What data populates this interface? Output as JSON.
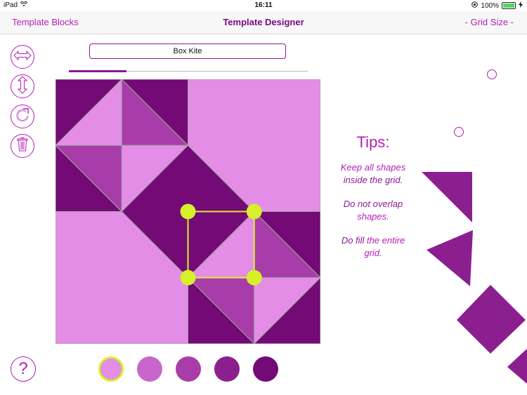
{
  "status_bar": {
    "device": "iPad",
    "time": "16:11",
    "battery": "100%",
    "battery_level": 1.0
  },
  "nav": {
    "left_label": "Template Blocks",
    "title": "Template Designer",
    "right_label": "- Grid Size -"
  },
  "template_name": {
    "value": "Box Kite"
  },
  "progress": {
    "value": 0.24
  },
  "tools": [
    {
      "name": "flip-horizontal-icon"
    },
    {
      "name": "flip-vertical-icon"
    },
    {
      "name": "rotate-icon"
    },
    {
      "name": "trash-icon"
    }
  ],
  "tips": {
    "title": "Tips:",
    "tip1_a": "Keep all shapes",
    "tip1_b": "inside the grid",
    "tip2_a": "Do not overlap",
    "tip2_b": "shapes",
    "tip3_a": "Do fill",
    "tip3_b": "the entire",
    "tip3_c": "grid"
  },
  "help": {
    "label": "?"
  },
  "colors": {
    "shade1": "#e48de6",
    "shade2": "#c966cc",
    "shade3": "#a83ca9",
    "shade4": "#8c1f8f",
    "shade5": "#730a76",
    "selection": "#d6f02a",
    "accent": "#b31fb5"
  },
  "palette": [
    {
      "color": "#e48de6",
      "selected": true
    },
    {
      "color": "#c966cc",
      "selected": false
    },
    {
      "color": "#a83ca9",
      "selected": false
    },
    {
      "color": "#8c1f8f",
      "selected": false
    },
    {
      "color": "#730a76",
      "selected": false
    }
  ]
}
